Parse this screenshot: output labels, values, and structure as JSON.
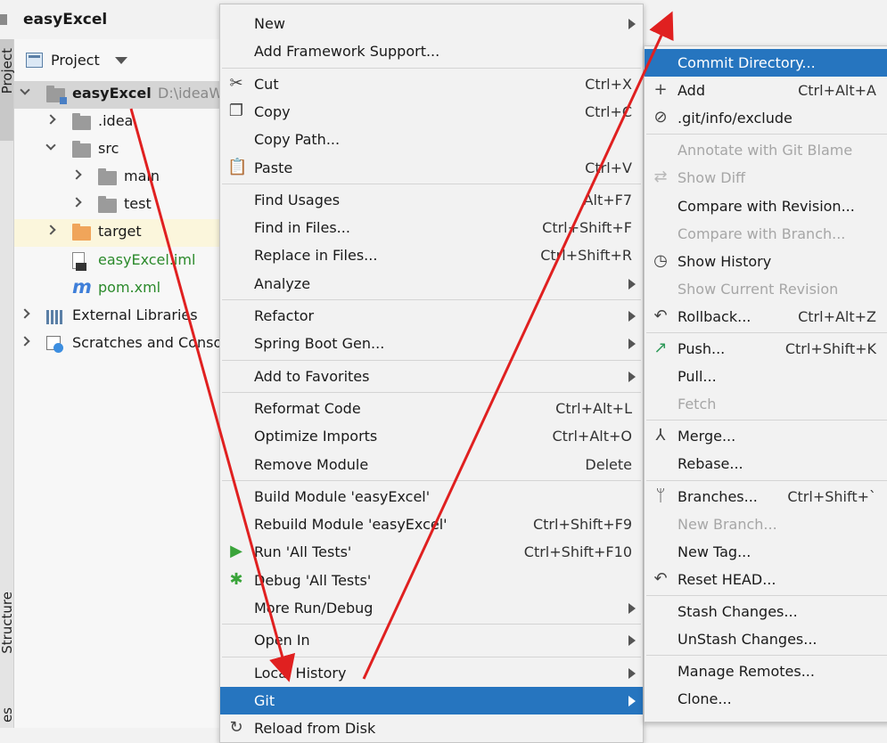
{
  "window": {
    "title": "easyExcel"
  },
  "side_tabs": {
    "top": "Project",
    "bottom": "Structure",
    "bottom2": "es"
  },
  "project_panel": {
    "header_label": "Project",
    "tree": [
      {
        "label": "easyExcel",
        "path": "D:\\ideaW",
        "kind": "module",
        "expand": "down",
        "indent": 0
      },
      {
        "label": ".idea",
        "kind": "folder",
        "expand": "right",
        "indent": 1
      },
      {
        "label": "src",
        "kind": "folder",
        "expand": "down",
        "indent": 1
      },
      {
        "label": "main",
        "kind": "folder",
        "expand": "right",
        "indent": 2
      },
      {
        "label": "test",
        "kind": "folder",
        "expand": "right",
        "indent": 2
      },
      {
        "label": "target",
        "kind": "orange-folder",
        "expand": "right",
        "indent": 1
      },
      {
        "label": "easyExcel.iml",
        "kind": "iml-file",
        "expand": "none",
        "indent": 1
      },
      {
        "label": "pom.xml",
        "kind": "maven-file",
        "expand": "none",
        "indent": 1
      },
      {
        "label": "External Libraries",
        "kind": "libraries",
        "expand": "right",
        "indent": 0
      },
      {
        "label": "Scratches and Conso",
        "kind": "scratches",
        "expand": "right",
        "indent": 0
      }
    ]
  },
  "context_menu": {
    "items": [
      {
        "label": "New",
        "shortcut": "",
        "submenu": true,
        "icon": ""
      },
      {
        "label": "Add Framework Support...",
        "shortcut": "",
        "submenu": false,
        "icon": ""
      },
      {
        "sep": true
      },
      {
        "label": "Cut",
        "shortcut": "Ctrl+X",
        "submenu": false,
        "icon": "scissors-icon"
      },
      {
        "label": "Copy",
        "shortcut": "Ctrl+C",
        "submenu": false,
        "icon": "copy-icon"
      },
      {
        "label": "Copy Path...",
        "shortcut": "",
        "submenu": false,
        "icon": ""
      },
      {
        "label": "Paste",
        "shortcut": "Ctrl+V",
        "submenu": false,
        "icon": "paste-icon"
      },
      {
        "sep": true
      },
      {
        "label": "Find Usages",
        "shortcut": "Alt+F7",
        "submenu": false,
        "icon": ""
      },
      {
        "label": "Find in Files...",
        "shortcut": "Ctrl+Shift+F",
        "submenu": false,
        "icon": ""
      },
      {
        "label": "Replace in Files...",
        "shortcut": "Ctrl+Shift+R",
        "submenu": false,
        "icon": ""
      },
      {
        "label": "Analyze",
        "shortcut": "",
        "submenu": true,
        "icon": ""
      },
      {
        "sep": true
      },
      {
        "label": "Refactor",
        "shortcut": "",
        "submenu": true,
        "icon": ""
      },
      {
        "label": "Spring Boot Gen...",
        "shortcut": "",
        "submenu": true,
        "icon": ""
      },
      {
        "sep": true
      },
      {
        "label": "Add to Favorites",
        "shortcut": "",
        "submenu": true,
        "icon": ""
      },
      {
        "sep": true
      },
      {
        "label": "Reformat Code",
        "shortcut": "Ctrl+Alt+L",
        "submenu": false,
        "icon": ""
      },
      {
        "label": "Optimize Imports",
        "shortcut": "Ctrl+Alt+O",
        "submenu": false,
        "icon": ""
      },
      {
        "label": "Remove Module",
        "shortcut": "Delete",
        "submenu": false,
        "icon": ""
      },
      {
        "sep": true
      },
      {
        "label": "Build Module 'easyExcel'",
        "shortcut": "",
        "submenu": false,
        "icon": ""
      },
      {
        "label": "Rebuild Module 'easyExcel'",
        "shortcut": "Ctrl+Shift+F9",
        "submenu": false,
        "icon": ""
      },
      {
        "label": "Run 'All Tests'",
        "shortcut": "Ctrl+Shift+F10",
        "submenu": false,
        "icon": "run-icon"
      },
      {
        "label": "Debug 'All Tests'",
        "shortcut": "",
        "submenu": false,
        "icon": "debug-icon"
      },
      {
        "label": "More Run/Debug",
        "shortcut": "",
        "submenu": true,
        "icon": ""
      },
      {
        "sep": true
      },
      {
        "label": "Open In",
        "shortcut": "",
        "submenu": true,
        "icon": ""
      },
      {
        "sep": true
      },
      {
        "label": "Local History",
        "shortcut": "",
        "submenu": true,
        "icon": ""
      },
      {
        "label": "Git",
        "shortcut": "",
        "submenu": true,
        "icon": "",
        "active": true
      },
      {
        "label": "Reload from Disk",
        "shortcut": "",
        "submenu": false,
        "icon": "reload-icon"
      }
    ]
  },
  "git_menu": {
    "items": [
      {
        "label": "Commit Directory...",
        "shortcut": "",
        "icon": "",
        "active": true
      },
      {
        "label": "Add",
        "shortcut": "Ctrl+Alt+A",
        "icon": "plus-icon"
      },
      {
        "label": ".git/info/exclude",
        "shortcut": "",
        "icon": "exclude-icon"
      },
      {
        "sep": true
      },
      {
        "label": "Annotate with Git Blame",
        "shortcut": "",
        "icon": "",
        "disabled": true
      },
      {
        "label": "Show Diff",
        "shortcut": "",
        "icon": "diff-icon",
        "disabled": true
      },
      {
        "label": "Compare with Revision...",
        "shortcut": "",
        "icon": ""
      },
      {
        "label": "Compare with Branch...",
        "shortcut": "",
        "icon": "",
        "disabled": true
      },
      {
        "label": "Show History",
        "shortcut": "",
        "icon": "clock-icon"
      },
      {
        "label": "Show Current Revision",
        "shortcut": "",
        "icon": "",
        "disabled": true
      },
      {
        "label": "Rollback...",
        "shortcut": "Ctrl+Alt+Z",
        "icon": "undo-icon"
      },
      {
        "sep": true
      },
      {
        "label": "Push...",
        "shortcut": "Ctrl+Shift+K",
        "icon": "push-icon"
      },
      {
        "label": "Pull...",
        "shortcut": "",
        "icon": ""
      },
      {
        "label": "Fetch",
        "shortcut": "",
        "icon": "",
        "disabled": true
      },
      {
        "sep": true
      },
      {
        "label": "Merge...",
        "shortcut": "",
        "icon": "merge-icon"
      },
      {
        "label": "Rebase...",
        "shortcut": "",
        "icon": ""
      },
      {
        "sep": true
      },
      {
        "label": "Branches...",
        "shortcut": "Ctrl+Shift+`",
        "icon": "branch-icon"
      },
      {
        "label": "New Branch...",
        "shortcut": "",
        "icon": "",
        "disabled": true
      },
      {
        "label": "New Tag...",
        "shortcut": "",
        "icon": ""
      },
      {
        "label": "Reset HEAD...",
        "shortcut": "",
        "icon": "undo-icon"
      },
      {
        "sep": true
      },
      {
        "label": "Stash Changes...",
        "shortcut": "",
        "icon": ""
      },
      {
        "label": "UnStash Changes...",
        "shortcut": "",
        "icon": ""
      },
      {
        "sep": true
      },
      {
        "label": "Manage Remotes...",
        "shortcut": "",
        "icon": ""
      },
      {
        "label": "Clone...",
        "shortcut": "",
        "icon": ""
      }
    ]
  },
  "colors": {
    "accent": "#2675bf",
    "annotation": "#e02020"
  }
}
